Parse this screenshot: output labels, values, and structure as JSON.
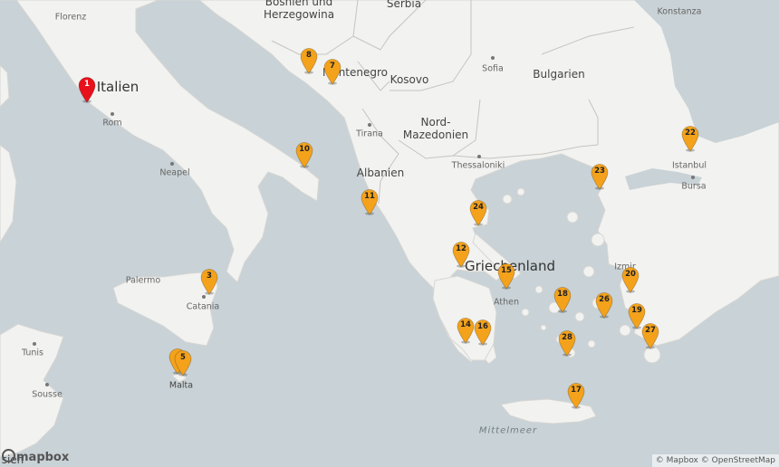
{
  "labels": {
    "italien": "Italien",
    "bosnien": "Bosnien und",
    "herzegowina": "Herzegowina",
    "serbia": "Serbia",
    "montenegro": "Montenegro",
    "kosovo": "Kosovo",
    "bulgarien": "Bulgarien",
    "nordmazedonien_1": "Nord-",
    "nordmazedonien_2": "Mazedonien",
    "albanien": "Albanien",
    "griechenland": "Griechenland",
    "florenz": "Florenz",
    "rom": "Rom",
    "neapel": "Neapel",
    "tirana": "Tirana",
    "sofia": "Sofia",
    "thessaloniki": "Thessaloniki",
    "istanbul": "Istanbul",
    "bursa": "Bursa",
    "izmir": "Izmir",
    "athen": "Athen",
    "palermo": "Palermo",
    "catania": "Catania",
    "tunis": "Tunis",
    "sousse": "Sousse",
    "malta": "Malta",
    "konstanza": "Konstanza",
    "mittelmeer": "Mittelmeer",
    "sie": "sien"
  },
  "markers": [
    {
      "id": "1",
      "selected": true
    },
    {
      "id": "3"
    },
    {
      "id": "5"
    },
    {
      "id": "7"
    },
    {
      "id": "8"
    },
    {
      "id": "10"
    },
    {
      "id": "11"
    },
    {
      "id": "12"
    },
    {
      "id": "14"
    },
    {
      "id": "15"
    },
    {
      "id": "16"
    },
    {
      "id": "17"
    },
    {
      "id": "18"
    },
    {
      "id": "19"
    },
    {
      "id": "20"
    },
    {
      "id": "22"
    },
    {
      "id": "23"
    },
    {
      "id": "24"
    },
    {
      "id": "26"
    },
    {
      "id": "27"
    },
    {
      "id": "28"
    }
  ],
  "colors": {
    "marker": "#f4a21b",
    "marker_selected": "#e8111b",
    "water": "#c9d2d6",
    "land": "#f2f2f0"
  },
  "logo": "mapbox",
  "attribution": {
    "mapbox": "© Mapbox",
    "osm": "© OpenStreetMap"
  }
}
